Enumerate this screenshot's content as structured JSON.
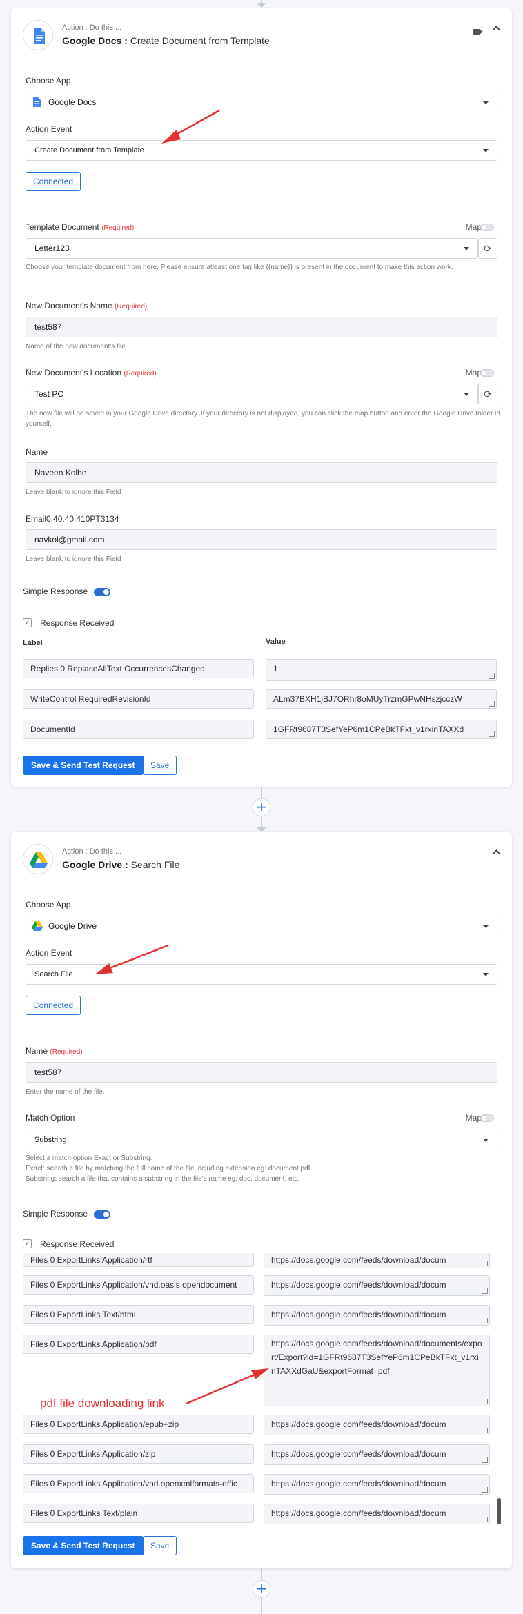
{
  "step1": {
    "subtitle": "Action : Do this ...",
    "app_name": "Google Docs :",
    "action_title": "Create Document from Template",
    "choose_app_label": "Choose App",
    "choose_app_value": "Google Docs",
    "action_event_label": "Action Event",
    "action_event_value": "Create Document from Template",
    "connected_label": "Connected",
    "map_label": "Map",
    "template_label": "Template Document",
    "required_tag": "(Required)",
    "template_value": "Letter123",
    "template_help": "Choose your template document from here. Please ensure atleast one tag like {{name}} is present in the document to make this action work.",
    "newname_label": "New Document's Name",
    "newname_value": "test587",
    "newname_help": "Name of the new document's file.",
    "location_label": "New Document's Location",
    "location_value": "Test PC",
    "location_help": "The new file will be saved in your Google Drive directory. If your directory is not displayed, you can click the map button and enter the Google Drive folder id yourself.",
    "name_label": "Name",
    "name_value": "Naveen Kolhe",
    "name_help": "Leave blank to ignore this Field",
    "email_label": "Email0.40.40.410PT3134",
    "email_value": "navkol@gmail.com",
    "email_help": "Leave blank to ignore this Field",
    "simple_response_label": "Simple Response",
    "response_received_label": "Response Received",
    "col_label": "Label",
    "col_value": "Value",
    "rows": [
      {
        "label": "Replies 0 ReplaceAllText OccurrencesChanged",
        "value": "1"
      },
      {
        "label": "WriteControl RequiredRevisionId",
        "value": "ALm37BXH1jBJ7ORhr8oMUyTrzmGPwNHszjcczW"
      },
      {
        "label": "DocumentId",
        "value": "1GFRt9687T3SefYeP6m1CPeBkTFxt_v1rxinTAXXd"
      }
    ],
    "save_test_label": "Save & Send Test Request",
    "save_label": "Save"
  },
  "step2": {
    "subtitle": "Action : Do this ...",
    "app_name": "Google Drive :",
    "action_title": "Search File",
    "choose_app_label": "Choose App",
    "choose_app_value": "Google Drive",
    "action_event_label": "Action Event",
    "action_event_value": "Search File",
    "connected_label": "Connected",
    "name_label": "Name",
    "required_tag": "(Required)",
    "name_value": "test587",
    "name_help": "Enter the name of the file.",
    "match_label": "Match Option",
    "map_label": "Map",
    "match_value": "Substring",
    "match_help_1": "Select a match option Exact or Substring.",
    "match_help_2": "Exact: search a file by matching the full name of the file including extension eg: document.pdf.",
    "match_help_3": "Substring: search a file that contains a substring in the file's name eg: doc, document, etc.",
    "simple_response_label": "Simple Response",
    "response_received_label": "Response Received",
    "rows": [
      {
        "label": "Files 0 ExportLinks Application/rtf",
        "value": "https://docs.google.com/feeds/download/docum"
      },
      {
        "label": "Files 0 ExportLinks Application/vnd.oasis.opendocument",
        "value": "https://docs.google.com/feeds/download/docum"
      },
      {
        "label": "Files 0 ExportLinks Text/html",
        "value": "https://docs.google.com/feeds/download/docum"
      },
      {
        "label": "Files 0 ExportLinks Application/pdf",
        "value": "https://docs.google.com/feeds/download/documents/export/Export?id=1GFRt9687T3SefYeP6m1CPeBkTFxt_v1rxinTAXXdGaU&exportFormat=pdf"
      },
      {
        "label": "Files 0 ExportLinks Application/epub+zip",
        "value": "https://docs.google.com/feeds/download/docum"
      },
      {
        "label": "Files 0 ExportLinks Application/zip",
        "value": "https://docs.google.com/feeds/download/docum"
      },
      {
        "label": "Files 0 ExportLinks Application/vnd.openxmlformats-offic",
        "value": "https://docs.google.com/feeds/download/docum"
      },
      {
        "label": "Files 0 ExportLinks Text/plain",
        "value": "https://docs.google.com/feeds/download/docum"
      }
    ],
    "annotation": "pdf file downloading link",
    "save_test_label": "Save & Send Test Request",
    "save_label": "Save"
  },
  "plus_symbol": "+",
  "colors": {
    "accent": "#1a73e8",
    "annotation": "#e53030"
  }
}
